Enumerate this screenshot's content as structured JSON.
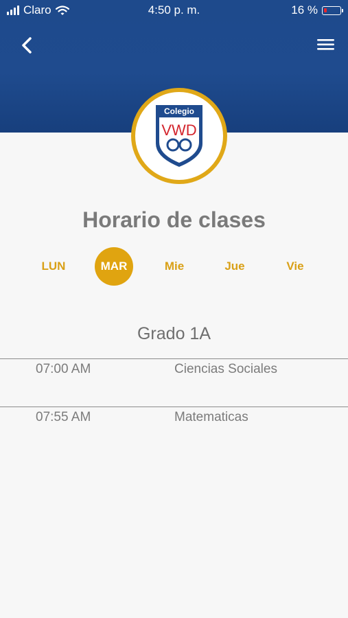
{
  "status_bar": {
    "carrier": "Claro",
    "time": "4:50 p. m.",
    "battery_percent": "16 %",
    "battery_level": 0.16
  },
  "header": {
    "back_icon": "chevron-left-icon",
    "menu_icon": "hamburger-menu-icon",
    "logo": {
      "top_text": "Colegio",
      "main_text": "VWD"
    }
  },
  "page": {
    "title": "Horario de clases"
  },
  "days": [
    {
      "label": "LUN",
      "active": false
    },
    {
      "label": "MAR",
      "active": true
    },
    {
      "label": "Mie",
      "active": false
    },
    {
      "label": "Jue",
      "active": false
    },
    {
      "label": "Vie",
      "active": false
    }
  ],
  "schedule": {
    "grade": "Grado 1A",
    "rows": [
      {
        "time": "07:00 AM",
        "subject": "Ciencias Sociales"
      },
      {
        "time": "07:55 AM",
        "subject": "Matematicas"
      }
    ]
  },
  "colors": {
    "header_blue": "#1e4a8c",
    "accent_gold": "#e0a410",
    "text_gray": "#7a7a7a"
  }
}
